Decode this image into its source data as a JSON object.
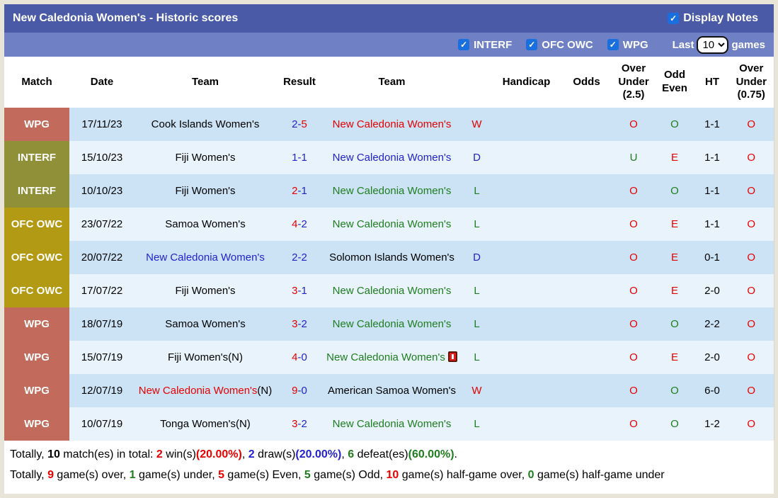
{
  "header": {
    "title": "New Caledonia Women's - Historic scores",
    "display_notes": {
      "label": "Display Notes",
      "checked": true
    },
    "filters": [
      {
        "label": "INTERF",
        "checked": true
      },
      {
        "label": "OFC OWC",
        "checked": true
      },
      {
        "label": "WPG",
        "checked": true
      }
    ],
    "last_label": "Last",
    "games_count": "10",
    "games_label": "games"
  },
  "colors": {
    "titlebar": "#4a5aa6",
    "filterbar": "#7080c4",
    "checkbox": "#1a6fdf",
    "row_dark": "#cbe3f5",
    "row_light": "#e8f3fb",
    "win_red": "#e60000",
    "draw_blue": "#2323cd",
    "loss_green": "#1f7d1f",
    "league_colors": {
      "WPG": "#c26b5c",
      "INTERF": "#8f9038",
      "OFC OWC": "#b39a15"
    }
  },
  "table": {
    "columns": [
      "Match",
      "Date",
      "Team",
      "Result",
      "Team",
      "",
      "Handicap",
      "Odds",
      "Over Under (2.5)",
      "Odd Even",
      "HT",
      "Over Under (0.75)"
    ],
    "rows": [
      {
        "league": "WPG",
        "date": "17/11/23",
        "home": "Cook Islands Women's",
        "home_color": "black",
        "home_suffix": "",
        "score_home": "2",
        "score_home_color": "blue",
        "score_away": "5",
        "score_away_color": "red",
        "away": "New Caledonia Women's",
        "away_color": "red",
        "away_icon": "",
        "outcome": "W",
        "outcome_color": "red",
        "handicap": "",
        "odds": "",
        "over_under_25": "O",
        "over_under_25_color": "red",
        "odd_even": "O",
        "odd_even_color": "green",
        "ht": "1-1",
        "over_under_075": "O",
        "over_under_075_color": "red"
      },
      {
        "league": "INTERF",
        "date": "15/10/23",
        "home": "Fiji Women's",
        "home_color": "black",
        "home_suffix": "",
        "score_home": "1",
        "score_home_color": "blue",
        "score_away": "1",
        "score_away_color": "blue",
        "away": "New Caledonia Women's",
        "away_color": "blue",
        "away_icon": "",
        "outcome": "D",
        "outcome_color": "blue",
        "handicap": "",
        "odds": "",
        "over_under_25": "U",
        "over_under_25_color": "green",
        "odd_even": "E",
        "odd_even_color": "red",
        "ht": "1-1",
        "over_under_075": "O",
        "over_under_075_color": "red"
      },
      {
        "league": "INTERF",
        "date": "10/10/23",
        "home": "Fiji Women's",
        "home_color": "black",
        "home_suffix": "",
        "score_home": "2",
        "score_home_color": "red",
        "score_away": "1",
        "score_away_color": "blue",
        "away": "New Caledonia Women's",
        "away_color": "green",
        "away_icon": "",
        "outcome": "L",
        "outcome_color": "green",
        "handicap": "",
        "odds": "",
        "over_under_25": "O",
        "over_under_25_color": "red",
        "odd_even": "O",
        "odd_even_color": "green",
        "ht": "1-1",
        "over_under_075": "O",
        "over_under_075_color": "red"
      },
      {
        "league": "OFC OWC",
        "date": "23/07/22",
        "home": "Samoa Women's",
        "home_color": "black",
        "home_suffix": "",
        "score_home": "4",
        "score_home_color": "red",
        "score_away": "2",
        "score_away_color": "blue",
        "away": "New Caledonia Women's",
        "away_color": "green",
        "away_icon": "",
        "outcome": "L",
        "outcome_color": "green",
        "handicap": "",
        "odds": "",
        "over_under_25": "O",
        "over_under_25_color": "red",
        "odd_even": "E",
        "odd_even_color": "red",
        "ht": "1-1",
        "over_under_075": "O",
        "over_under_075_color": "red"
      },
      {
        "league": "OFC OWC",
        "date": "20/07/22",
        "home": "New Caledonia Women's",
        "home_color": "blue",
        "home_suffix": "",
        "score_home": "2",
        "score_home_color": "blue",
        "score_away": "2",
        "score_away_color": "blue",
        "away": "Solomon Islands Women's",
        "away_color": "black",
        "away_icon": "",
        "outcome": "D",
        "outcome_color": "blue",
        "handicap": "",
        "odds": "",
        "over_under_25": "O",
        "over_under_25_color": "red",
        "odd_even": "E",
        "odd_even_color": "red",
        "ht": "0-1",
        "over_under_075": "O",
        "over_under_075_color": "red"
      },
      {
        "league": "OFC OWC",
        "date": "17/07/22",
        "home": "Fiji Women's",
        "home_color": "black",
        "home_suffix": "",
        "score_home": "3",
        "score_home_color": "red",
        "score_away": "1",
        "score_away_color": "blue",
        "away": "New Caledonia Women's",
        "away_color": "green",
        "away_icon": "",
        "outcome": "L",
        "outcome_color": "green",
        "handicap": "",
        "odds": "",
        "over_under_25": "O",
        "over_under_25_color": "red",
        "odd_even": "E",
        "odd_even_color": "red",
        "ht": "2-0",
        "over_under_075": "O",
        "over_under_075_color": "red"
      },
      {
        "league": "WPG",
        "date": "18/07/19",
        "home": "Samoa Women's",
        "home_color": "black",
        "home_suffix": "",
        "score_home": "3",
        "score_home_color": "red",
        "score_away": "2",
        "score_away_color": "blue",
        "away": "New Caledonia Women's",
        "away_color": "green",
        "away_icon": "",
        "outcome": "L",
        "outcome_color": "green",
        "handicap": "",
        "odds": "",
        "over_under_25": "O",
        "over_under_25_color": "red",
        "odd_even": "O",
        "odd_even_color": "green",
        "ht": "2-2",
        "over_under_075": "O",
        "over_under_075_color": "red"
      },
      {
        "league": "WPG",
        "date": "15/07/19",
        "home": "Fiji Women's(N)",
        "home_color": "black",
        "home_suffix": "",
        "score_home": "4",
        "score_home_color": "red",
        "score_away": "0",
        "score_away_color": "blue",
        "away": "New Caledonia Women's",
        "away_color": "green",
        "away_icon": "red-card",
        "outcome": "L",
        "outcome_color": "green",
        "handicap": "",
        "odds": "",
        "over_under_25": "O",
        "over_under_25_color": "red",
        "odd_even": "E",
        "odd_even_color": "red",
        "ht": "2-0",
        "over_under_075": "O",
        "over_under_075_color": "red"
      },
      {
        "league": "WPG",
        "date": "12/07/19",
        "home": "New Caledonia Women's",
        "home_color": "red",
        "home_suffix": "(N)",
        "score_home": "9",
        "score_home_color": "red",
        "score_away": "0",
        "score_away_color": "blue",
        "away": "American Samoa Women's",
        "away_color": "black",
        "away_icon": "",
        "outcome": "W",
        "outcome_color": "red",
        "handicap": "",
        "odds": "",
        "over_under_25": "O",
        "over_under_25_color": "red",
        "odd_even": "O",
        "odd_even_color": "green",
        "ht": "6-0",
        "over_under_075": "O",
        "over_under_075_color": "red"
      },
      {
        "league": "WPG",
        "date": "10/07/19",
        "home": "Tonga Women's(N)",
        "home_color": "black",
        "home_suffix": "",
        "score_home": "3",
        "score_home_color": "red",
        "score_away": "2",
        "score_away_color": "blue",
        "away": "New Caledonia Women's",
        "away_color": "green",
        "away_icon": "",
        "outcome": "L",
        "outcome_color": "green",
        "handicap": "",
        "odds": "",
        "over_under_25": "O",
        "over_under_25_color": "red",
        "odd_even": "O",
        "odd_even_color": "green",
        "ht": "1-2",
        "over_under_075": "O",
        "over_under_075_color": "red"
      }
    ]
  },
  "footer": {
    "line1": [
      {
        "text": "Totally, ",
        "color": "black",
        "bold": false
      },
      {
        "text": "10",
        "color": "black",
        "bold": true
      },
      {
        "text": " match(es) in total: ",
        "color": "black",
        "bold": false
      },
      {
        "text": "2",
        "color": "red",
        "bold": true
      },
      {
        "text": " win(s)",
        "color": "black",
        "bold": false
      },
      {
        "text": "(20.00%)",
        "color": "red",
        "bold": true
      },
      {
        "text": ", ",
        "color": "black",
        "bold": false
      },
      {
        "text": "2",
        "color": "blue",
        "bold": true
      },
      {
        "text": " draw(s)",
        "color": "black",
        "bold": false
      },
      {
        "text": "(20.00%)",
        "color": "blue",
        "bold": true
      },
      {
        "text": ", ",
        "color": "black",
        "bold": false
      },
      {
        "text": "6",
        "color": "green",
        "bold": true
      },
      {
        "text": " defeat(es)",
        "color": "black",
        "bold": false
      },
      {
        "text": "(60.00%)",
        "color": "green",
        "bold": true
      },
      {
        "text": ".",
        "color": "black",
        "bold": false
      }
    ],
    "line2": [
      {
        "text": "Totally, ",
        "color": "black",
        "bold": false
      },
      {
        "text": "9",
        "color": "red",
        "bold": true
      },
      {
        "text": " game(s) over, ",
        "color": "black",
        "bold": false
      },
      {
        "text": "1",
        "color": "green",
        "bold": true
      },
      {
        "text": " game(s) under, ",
        "color": "black",
        "bold": false
      },
      {
        "text": "5",
        "color": "red",
        "bold": true
      },
      {
        "text": " game(s) Even, ",
        "color": "black",
        "bold": false
      },
      {
        "text": "5",
        "color": "green",
        "bold": true
      },
      {
        "text": " game(s) Odd, ",
        "color": "black",
        "bold": false
      },
      {
        "text": "10",
        "color": "red",
        "bold": true
      },
      {
        "text": " game(s) half-game over, ",
        "color": "black",
        "bold": false
      },
      {
        "text": "0",
        "color": "green",
        "bold": true
      },
      {
        "text": " game(s) half-game under",
        "color": "black",
        "bold": false
      }
    ]
  }
}
